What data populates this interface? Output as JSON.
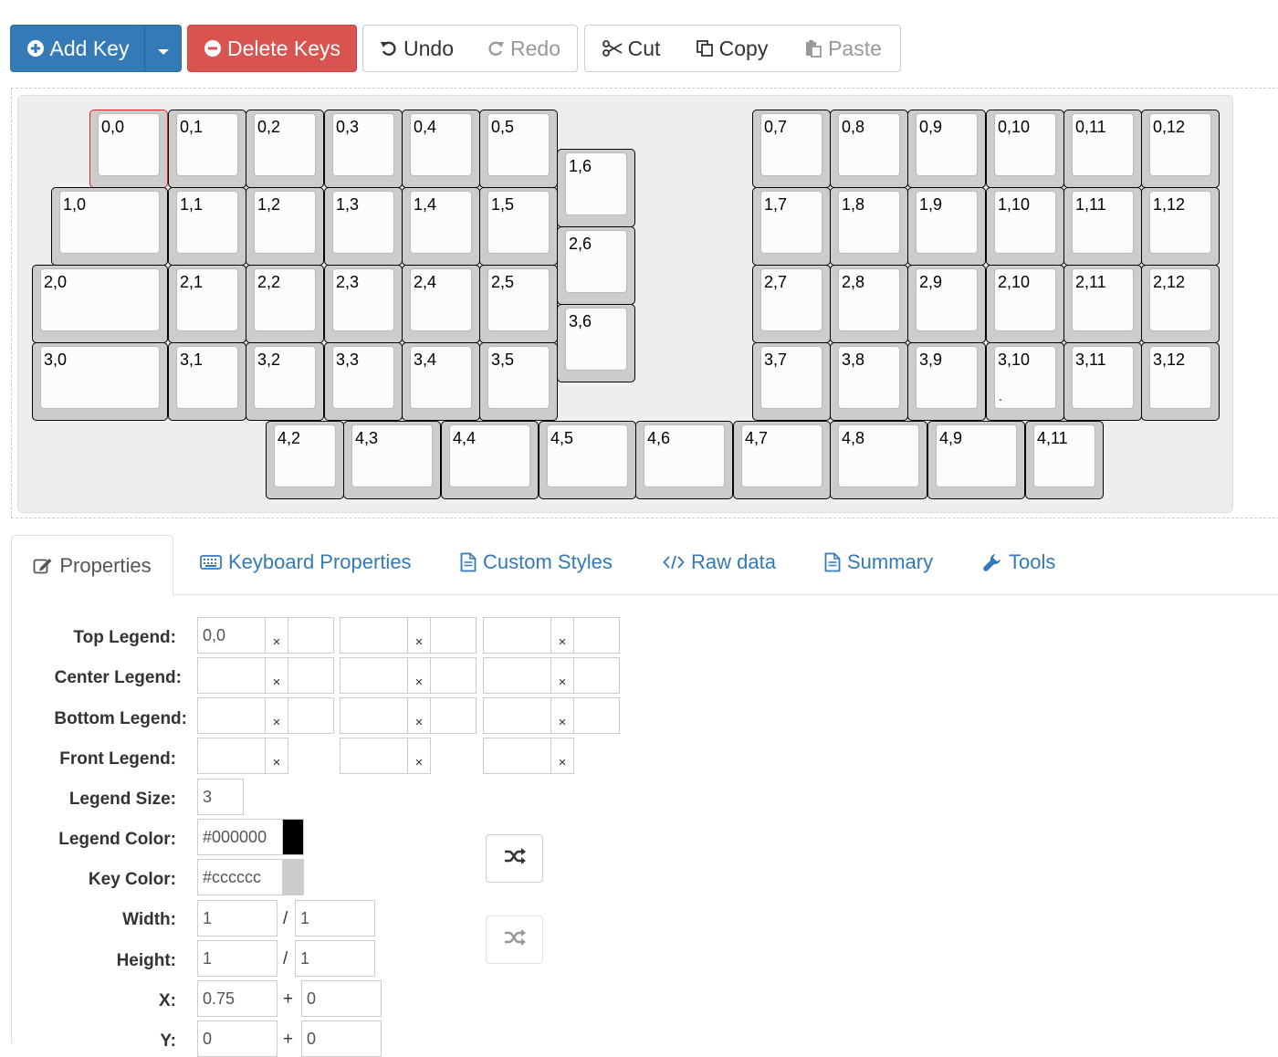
{
  "toolbar": {
    "add_key": "Add Key",
    "delete_keys": "Delete Keys",
    "undo": "Undo",
    "redo": "Redo",
    "cut": "Cut",
    "copy": "Copy",
    "paste": "Paste"
  },
  "keys": [
    {
      "label": "0,0",
      "selected": true
    },
    {
      "label": "0,1"
    },
    {
      "label": "0,2"
    },
    {
      "label": "0,3"
    },
    {
      "label": "0,4"
    },
    {
      "label": "0,5"
    },
    {
      "label": "1,6"
    },
    {
      "label": "0,7"
    },
    {
      "label": "0,8"
    },
    {
      "label": "0,9"
    },
    {
      "label": "0,10"
    },
    {
      "label": "0,11"
    },
    {
      "label": "0,12"
    },
    {
      "label": "1,0"
    },
    {
      "label": "1,1"
    },
    {
      "label": "1,2"
    },
    {
      "label": "1,3"
    },
    {
      "label": "1,4"
    },
    {
      "label": "1,5"
    },
    {
      "label": "2,6"
    },
    {
      "label": "1,7"
    },
    {
      "label": "1,8"
    },
    {
      "label": "1,9"
    },
    {
      "label": "1,10"
    },
    {
      "label": "1,11"
    },
    {
      "label": "1,12"
    },
    {
      "label": "2,0"
    },
    {
      "label": "2,1"
    },
    {
      "label": "2,2"
    },
    {
      "label": "2,3"
    },
    {
      "label": "2,4"
    },
    {
      "label": "2,5"
    },
    {
      "label": "3,6"
    },
    {
      "label": "2,7"
    },
    {
      "label": "2,8"
    },
    {
      "label": "2,9"
    },
    {
      "label": "2,10"
    },
    {
      "label": "2,11"
    },
    {
      "label": "2,12"
    },
    {
      "label": "3,0"
    },
    {
      "label": "3,1"
    },
    {
      "label": "3,2"
    },
    {
      "label": "3,3"
    },
    {
      "label": "3,4"
    },
    {
      "label": "3,5"
    },
    {
      "label": "3,7"
    },
    {
      "label": "3,8"
    },
    {
      "label": "3,9"
    },
    {
      "label": "3,10",
      "sub": "."
    },
    {
      "label": "3,11"
    },
    {
      "label": "3,12"
    },
    {
      "label": "4,2"
    },
    {
      "label": "4,3"
    },
    {
      "label": "4,4"
    },
    {
      "label": "4,5"
    },
    {
      "label": "4,6"
    },
    {
      "label": "4,7"
    },
    {
      "label": "4,8"
    },
    {
      "label": "4,9"
    },
    {
      "label": "4,11"
    }
  ],
  "tabs": {
    "properties": "Properties",
    "keyboard_properties": "Keyboard Properties",
    "custom_styles": "Custom Styles",
    "raw_data": "Raw data",
    "summary": "Summary",
    "tools": "Tools"
  },
  "form": {
    "top_legend_label": "Top Legend:",
    "center_legend_label": "Center Legend:",
    "bottom_legend_label": "Bottom Legend:",
    "front_legend_label": "Front Legend:",
    "legend_size_label": "Legend Size:",
    "legend_color_label": "Legend Color:",
    "key_color_label": "Key Color:",
    "width_label": "Width:",
    "height_label": "Height:",
    "x_label": "X:",
    "y_label": "Y:",
    "clear_glyph": "×",
    "slash": "/",
    "plus": "+",
    "top_legend_value": "0,0",
    "legend_size_value": "3",
    "legend_color_value": "#000000",
    "key_color_value": "#cccccc",
    "width_value": "1",
    "width2_value": "1",
    "height_value": "1",
    "height2_value": "1",
    "x_value": "0.75",
    "x2_value": "0",
    "y_value": "0",
    "y2_value": "0"
  },
  "colors": {
    "primary": "#337ab7",
    "danger": "#d9534f",
    "legend_color": "#000000",
    "key_color": "#cccccc",
    "selected_key_border": "#dd2222"
  }
}
